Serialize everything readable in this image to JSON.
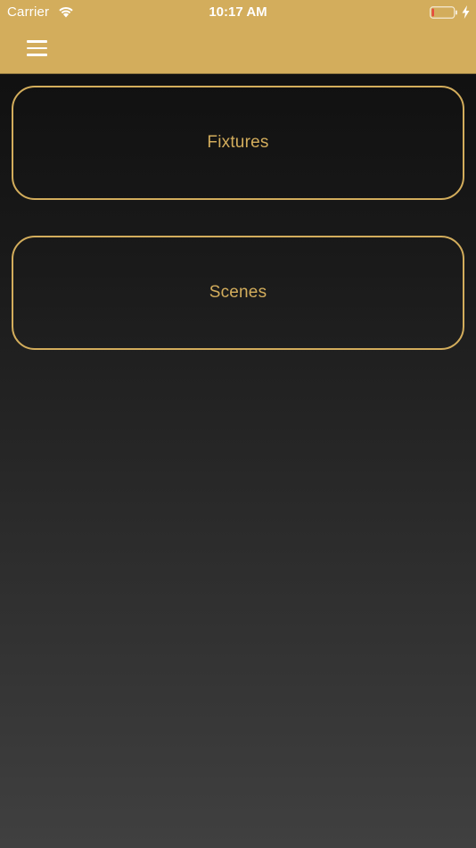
{
  "status_bar": {
    "carrier": "Carrier",
    "time": "10:17 AM",
    "battery_level": 0.1
  },
  "header": {
    "menu_icon": "hamburger-menu-icon"
  },
  "nav": {
    "items": [
      {
        "label": "Fixtures"
      },
      {
        "label": "Scenes"
      }
    ]
  },
  "colors": {
    "accent": "#d3ad5c",
    "battery_low": "#e8413a"
  }
}
